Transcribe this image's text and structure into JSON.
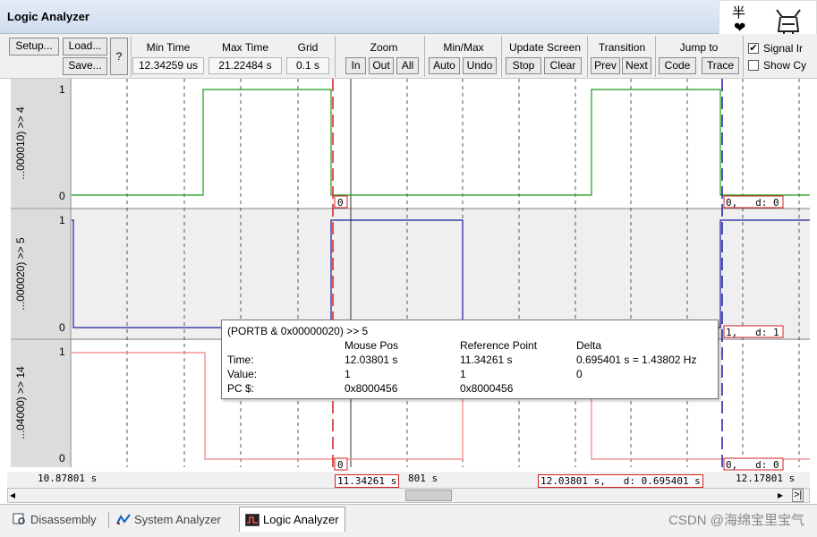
{
  "window": {
    "title": "Logic Analyzer"
  },
  "toolbar": {
    "setup": "Setup...",
    "load": "Load...",
    "save": "Save...",
    "help": "?",
    "min_time_label": "Min Time",
    "min_time_value": "12.34259 us",
    "max_time_label": "Max Time",
    "max_time_value": "21.22484 s",
    "grid_label": "Grid",
    "grid_value": "0.1 s",
    "zoom_label": "Zoom",
    "zoom_in": "In",
    "zoom_out": "Out",
    "zoom_all": "All",
    "minmax_label": "Min/Max",
    "minmax_auto": "Auto",
    "minmax_undo": "Undo",
    "update_label": "Update Screen",
    "update_stop": "Stop",
    "update_clear": "Clear",
    "transition_label": "Transition",
    "transition_prev": "Prev",
    "transition_next": "Next",
    "jump_label": "Jump to",
    "jump_code": "Code",
    "jump_trace": "Trace",
    "signal_info": "Signal Ir",
    "show_cycles": "Show Cy",
    "signal_info_checked": true,
    "show_cycles_checked": false
  },
  "logo": {
    "text": "半"
  },
  "signals": [
    {
      "name": "...000010) >> 4",
      "high": "1",
      "low": "0",
      "color": "#1a9a1a",
      "value_box": "0",
      "right_box": "0,   d: 0"
    },
    {
      "name": "...000020) >> 5",
      "high": "1",
      "low": "0",
      "color": "#1a1aa0",
      "value_box": "",
      "right_box": "1,   d: 1"
    },
    {
      "name": "...04000) >> 14",
      "high": "1",
      "low": "0",
      "color": "#f08080",
      "value_box": "0",
      "right_box": "0,   d: 0"
    }
  ],
  "time_axis": {
    "left_time": "10.87801 s",
    "cursor_time": "11.34261 s",
    "cursor_time_overlap": "801 s",
    "mouse_time": "12.03801 s,   d: 0.695401 s",
    "right_time": "12.17801 s"
  },
  "tooltip": {
    "title": "(PORTB & 0x00000020) >> 5",
    "col_mouse": "Mouse Pos",
    "col_ref": "Reference Point",
    "col_delta": "Delta",
    "row_time_label": "Time:",
    "row_time_mouse": "12.03801 s",
    "row_time_ref": "11.34261 s",
    "row_time_delta": "0.695401 s = 1.43802 Hz",
    "row_value_label": "Value:",
    "row_value_mouse": "1",
    "row_value_ref": "1",
    "row_value_delta": "0",
    "row_pc_label": "PC $:",
    "row_pc_mouse": "0x8000456",
    "row_pc_ref": "0x8000456"
  },
  "scroll": {
    "left_arrow": "◂",
    "right_arrow": "▸",
    "end": ">|"
  },
  "tabs": [
    {
      "label": "Disassembly",
      "active": false
    },
    {
      "label": "System Analyzer",
      "active": false
    },
    {
      "label": "Logic Analyzer",
      "active": true
    }
  ],
  "watermark": "CSDN @海绵宝里宝气",
  "colors": {
    "cursor_red": "#d02020",
    "mouse_blue": "#1a1aa0",
    "grid": "#555555",
    "band": "#efefef"
  }
}
